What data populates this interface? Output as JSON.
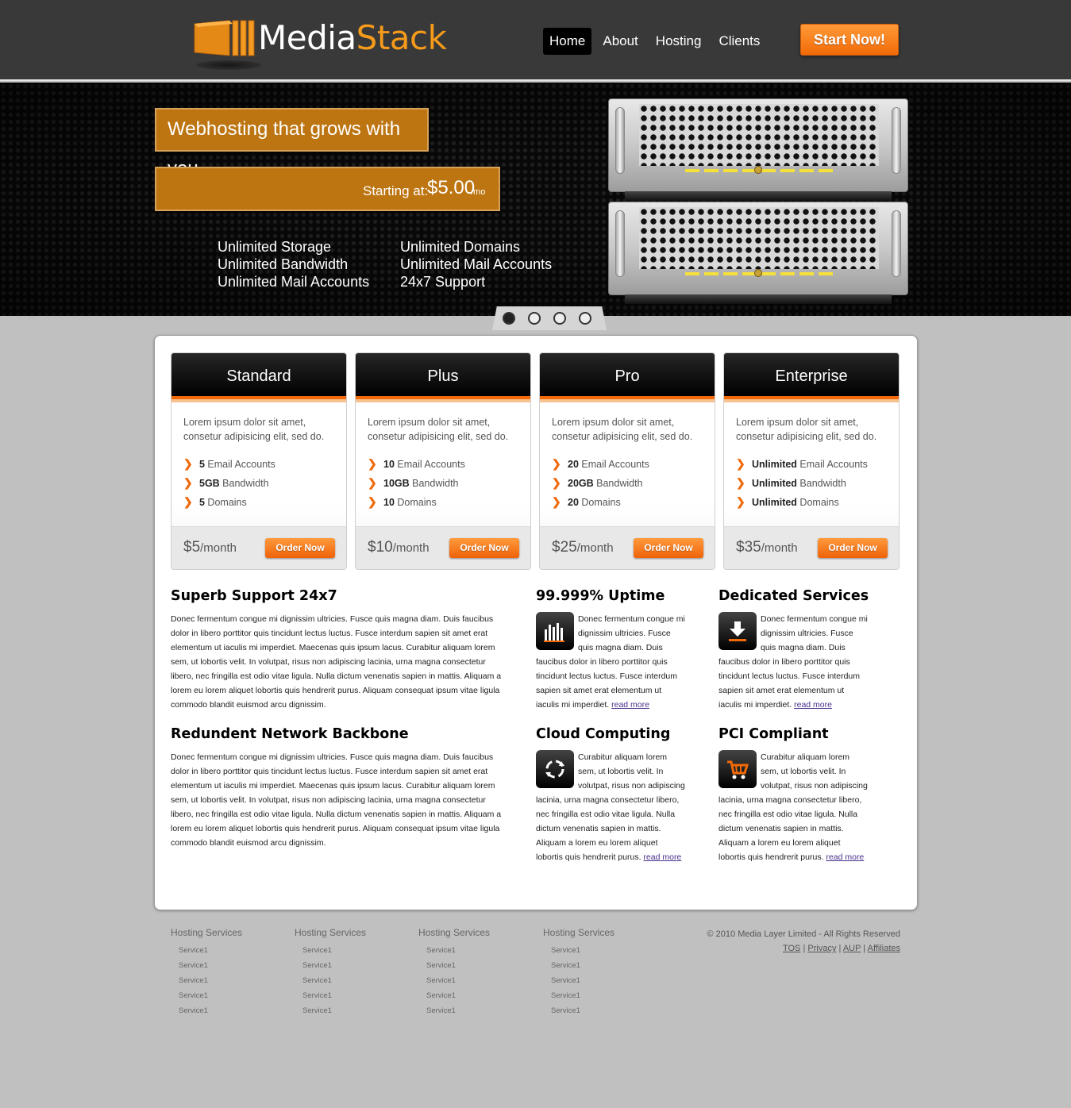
{
  "brand": {
    "part1": "Media",
    "part2": "Stack"
  },
  "nav": [
    {
      "label": "Home"
    },
    {
      "label": "About"
    },
    {
      "label": "Hosting"
    },
    {
      "label": "Clients"
    }
  ],
  "start_button": "Start Now!",
  "hero": {
    "tagline": "Webhosting that grows with you",
    "price_label": "Starting at:",
    "price_amount": "$5.00",
    "price_period": "/mo",
    "features_col1": [
      "Unlimited Storage",
      "Unlimited Bandwidth",
      "Unlimited Mail Accounts"
    ],
    "features_col2": [
      "Unlimited Domains",
      "Unlimited Mail Accounts",
      "24x7 Support"
    ],
    "slide_index": 1,
    "slide_count": 4
  },
  "plans": [
    {
      "name": "Standard",
      "desc": "Lorem ipsum dolor sit amet, consetur adipisicing elit, sed do.",
      "features": [
        {
          "value": "5",
          "label": " Email Accounts"
        },
        {
          "value": "5GB",
          "label": " Bandwidth"
        },
        {
          "value": "5",
          "label": " Domains"
        }
      ],
      "price": "$5",
      "period": "/month",
      "button": "Order Now"
    },
    {
      "name": "Plus",
      "desc": "Lorem ipsum dolor sit amet, consetur adipisicing elit, sed do.",
      "features": [
        {
          "value": "10",
          "label": " Email Accounts"
        },
        {
          "value": "10GB",
          "label": " Bandwidth"
        },
        {
          "value": "10",
          "label": " Domains"
        }
      ],
      "price": "$10",
      "period": "/month",
      "button": "Order Now"
    },
    {
      "name": "Pro",
      "desc": "Lorem ipsum dolor sit amet, consetur adipisicing elit, sed do.",
      "features": [
        {
          "value": "20",
          "label": " Email Accounts"
        },
        {
          "value": "20GB",
          "label": " Bandwidth"
        },
        {
          "value": "20",
          "label": " Domains"
        }
      ],
      "price": "$25",
      "period": "/month",
      "button": "Order Now"
    },
    {
      "name": "Enterprise",
      "desc": "Lorem ipsum dolor sit amet, consetur adipisicing elit, sed do.",
      "features": [
        {
          "value": "Unlimited",
          "label": " Email Accounts"
        },
        {
          "value": "Unlimited",
          "label": " Bandwidth"
        },
        {
          "value": "Unlimited",
          "label": " Domains"
        }
      ],
      "price": "$35",
      "period": "/month",
      "button": "Order Now"
    }
  ],
  "sections": {
    "support": {
      "title": "Superb Support 24x7",
      "body": "Donec fermentum congue mi dignissim ultricies. Fusce quis magna diam. Duis faucibus dolor in libero porttitor quis tincidunt lectus luctus. Fusce interdum sapien sit amet erat elementum ut iaculis mi imperdiet. Maecenas quis ipsum lacus. Curabitur aliquam lorem sem, ut lobortis velit. In volutpat, risus non adipiscing lacinia, urna magna consectetur libero, nec fringilla est odio vitae ligula. Nulla dictum venenatis sapien in mattis. Aliquam a lorem eu lorem aliquet lobortis quis hendrerit purus. Aliquam consequat ipsum vitae ligula commodo blandit euismod arcu dignissim."
    },
    "network": {
      "title": "Redundent Network Backbone",
      "body": "Donec fermentum congue mi dignissim ultricies. Fusce quis magna diam. Duis faucibus dolor in libero porttitor quis tincidunt lectus luctus. Fusce interdum sapien sit amet erat elementum ut iaculis mi imperdiet. Maecenas quis ipsum lacus. Curabitur aliquam lorem sem, ut lobortis velit. In volutpat, risus non adipiscing lacinia, urna magna consectetur libero, nec fringilla est odio vitae ligula. Nulla dictum venenatis sapien in mattis. Aliquam a lorem eu lorem aliquet lobortis quis hendrerit purus. Aliquam consequat ipsum vitae ligula commodo blandit euismod arcu dignissim."
    },
    "uptime": {
      "title": "99.999% Uptime",
      "icon": "bar-chart-icon",
      "body": "Donec fermentum congue mi dignissim ultricies. Fusce quis magna diam. Duis faucibus dolor in libero porttitor quis tincidunt lectus luctus. Fusce interdum sapien sit amet erat elementum ut iaculis mi imperdiet.",
      "link": "read more"
    },
    "dedicated": {
      "title": "Dedicated Services",
      "icon": "download-icon",
      "body": "Donec fermentum congue mi dignissim ultricies. Fusce quis magna diam. Duis faucibus dolor in libero porttitor quis tincidunt lectus luctus. Fusce interdum sapien sit amet erat elementum ut iaculis mi imperdiet.",
      "link": "read more"
    },
    "cloud": {
      "title": "Cloud Computing",
      "icon": "refresh-cycle-icon",
      "body": "Curabitur aliquam lorem sem, ut lobortis velit. In volutpat, risus non adipiscing lacinia, urna magna consectetur libero, nec fringilla est odio vitae ligula. Nulla dictum venenatis sapien in mattis. Aliquam a lorem eu lorem aliquet lobortis quis hendrerit purus.",
      "link": "read more"
    },
    "pci": {
      "title": "PCI Compliant",
      "icon": "shopping-cart-icon",
      "body": "Curabitur aliquam lorem sem, ut lobortis velit. In volutpat, risus non adipiscing lacinia, urna magna consectetur libero, nec fringilla est odio vitae ligula. Nulla dictum venenatis sapien in mattis. Aliquam a lorem eu lorem aliquet lobortis quis hendrerit purus.",
      "link": "read more"
    }
  },
  "footer": {
    "columns": [
      {
        "heading": "Hosting Services",
        "items": [
          "Service1",
          "Service1",
          "Service1",
          "Service1",
          "Service1"
        ]
      },
      {
        "heading": "Hosting Services",
        "items": [
          "Service1",
          "Service1",
          "Service1",
          "Service1",
          "Service1"
        ]
      },
      {
        "heading": "Hosting Services",
        "items": [
          "Service1",
          "Service1",
          "Service1",
          "Service1",
          "Service1"
        ]
      },
      {
        "heading": "Hosting Services",
        "items": [
          "Service1",
          "Service1",
          "Service1",
          "Service1",
          "Service1"
        ]
      }
    ],
    "copyright": "© 2010 Media Layer Limited - All Rights Reserved",
    "links": [
      "TOS",
      "Privacy",
      "AUP",
      "Affiliates"
    ]
  },
  "colors": {
    "accent": "#f26a08",
    "brand_orange": "#f59a1a",
    "hero_box": "#bd7512",
    "header_bg": "#393939",
    "page_bg": "#c0c0c0"
  }
}
